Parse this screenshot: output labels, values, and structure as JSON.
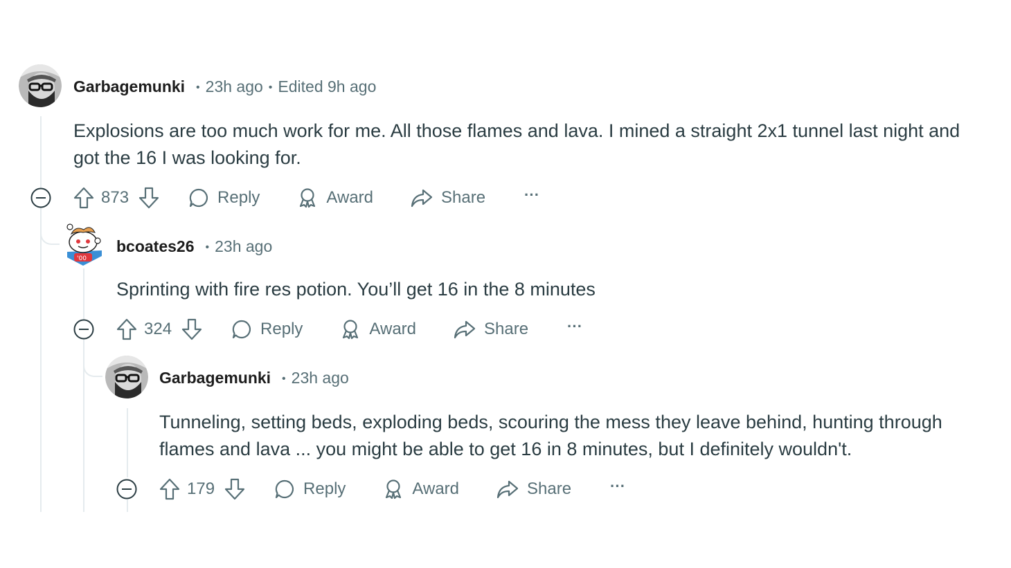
{
  "comments": [
    {
      "author": "Garbagemunki",
      "time": "23h ago",
      "edited": "Edited 9h ago",
      "body_lines": [
        "Explosions are too much work for me. All those flames and lava. I mined a straight 2x1 tunnel last night and",
        "got the 16 I was looking for."
      ],
      "score": "873",
      "avatar": "glasses-beard-avatar"
    },
    {
      "author": "bcoates26",
      "time": "23h ago",
      "body_lines": [
        "Sprinting with fire res potion. You’ll get 16 in the 8 minutes"
      ],
      "score": "324",
      "avatar": "snoo-avatar"
    },
    {
      "author": "Garbagemunki",
      "time": "23h ago",
      "body_lines": [
        "Tunneling, setting beds, exploding beds, scouring the mess they leave behind, hunting through",
        "flames and lava ... you might be able to get 16 in 8 minutes, but I definitely wouldn't."
      ],
      "score": "179",
      "avatar": "glasses-beard-avatar"
    }
  ],
  "labels": {
    "reply": "Reply",
    "award": "Award",
    "share": "Share",
    "more": "···"
  },
  "colors": {
    "muted_text": "#576f76",
    "body_text": "#2a3c42",
    "thread_line": "#e5ebee"
  }
}
